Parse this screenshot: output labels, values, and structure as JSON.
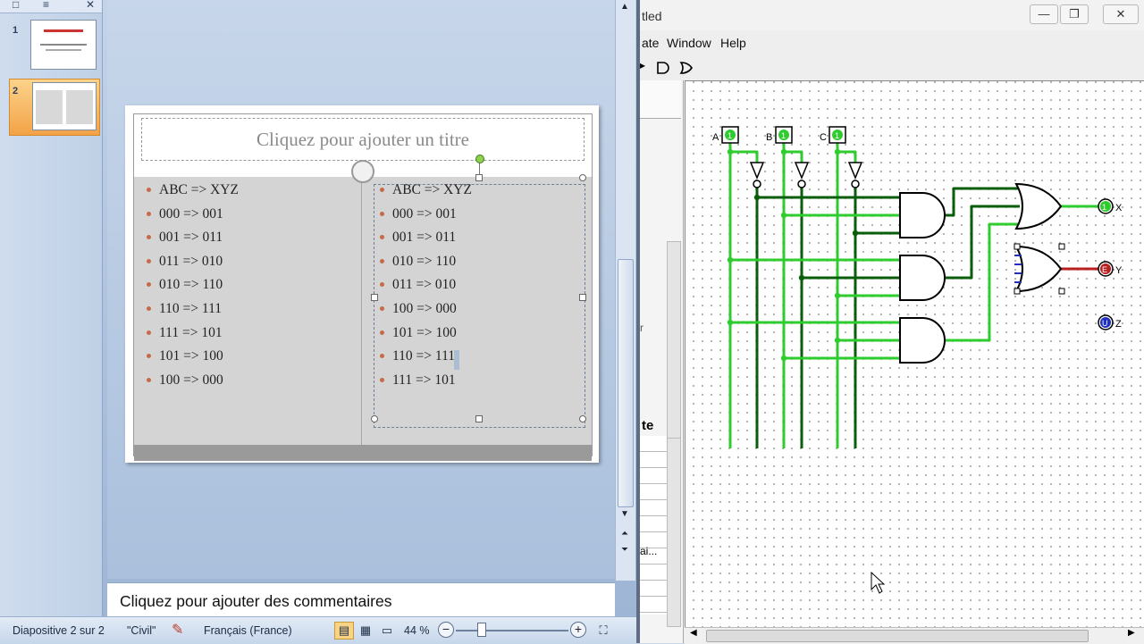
{
  "powerpoint": {
    "slides": [
      {
        "number": "1"
      },
      {
        "number": "2",
        "selected": true
      }
    ],
    "slide": {
      "title_placeholder": "Cliquez pour ajouter un titre",
      "left_list": [
        "ABC => XYZ",
        "000 => 001",
        "001 => 011",
        "011 => 010",
        "010 => 110",
        "110 => 111",
        "111 => 101",
        "101 => 100",
        "100 => 000"
      ],
      "right_list": [
        "ABC => XYZ",
        "000 => 001",
        "001 => 011",
        "010 => 110",
        "011 => 010",
        "100 => 000",
        "101 => 100",
        "110 => 111",
        "111 => 101"
      ]
    },
    "notes_placeholder": "Cliquez pour ajouter des commentaires",
    "statusbar": {
      "slide_info": "Diapositive 2 sur 2",
      "theme": "\"Civil\"",
      "language": "Français (France)",
      "zoom": "44 %"
    },
    "colors": {
      "accent_selected": "#f3a347",
      "bullet": "#c86a4a"
    }
  },
  "logisim": {
    "title_fragment": "tled",
    "menu": {
      "fragment": "ate",
      "window": "Window",
      "help": "Help"
    },
    "side_labels": {
      "r": "r",
      "te": "te",
      "ai": "ai..."
    },
    "pins": {
      "in_a": "A",
      "in_b": "B",
      "in_c": "C",
      "out_x": "X",
      "out_y": "Y",
      "out_z": "Z",
      "one": "1",
      "error": "E",
      "undefined": "U"
    },
    "colors": {
      "wire_on": "#2ecc2e",
      "wire_off": "#0a5d0a",
      "wire_error": "#b81f1f",
      "wire_wide": "#1f2fbf"
    }
  }
}
